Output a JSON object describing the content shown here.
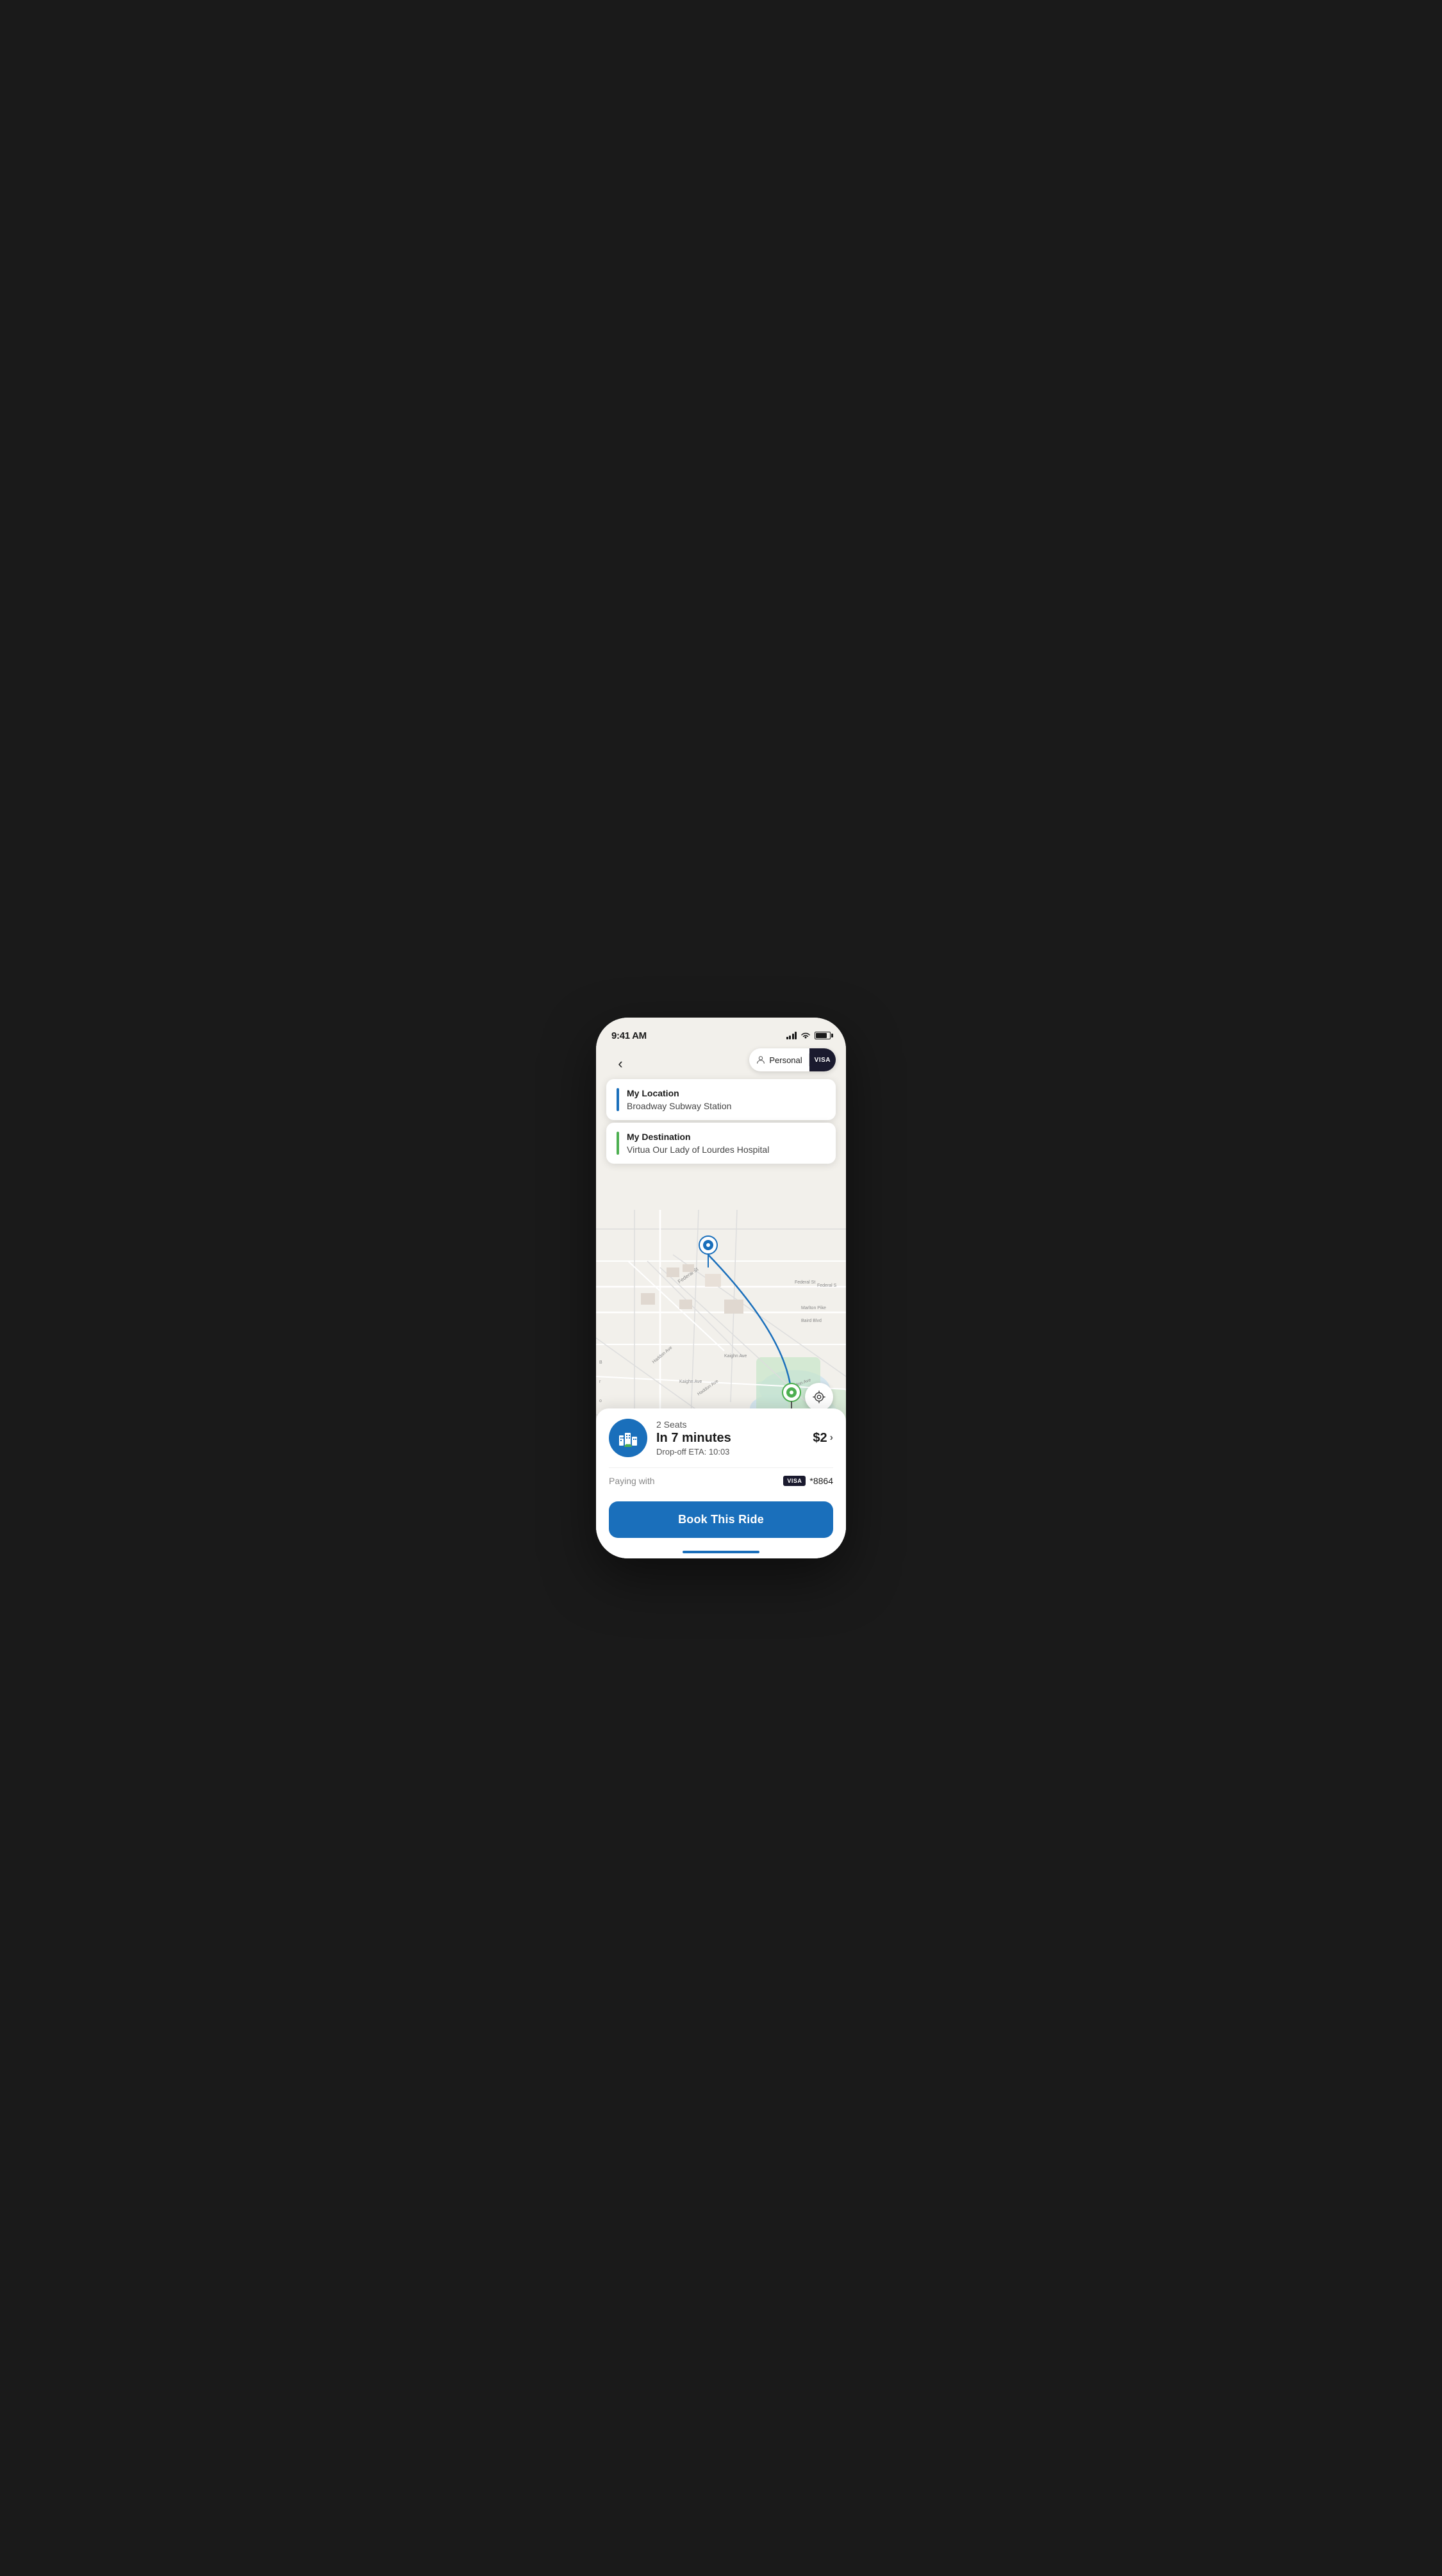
{
  "status_bar": {
    "time": "9:41 AM"
  },
  "header": {
    "account_type": "Personal",
    "card_label": "VISA",
    "back_label": "<"
  },
  "location": {
    "origin_label": "My Location",
    "origin_value": "Broadway Subway Station",
    "destination_label": "My Destination",
    "destination_value": "Virtua Our Lady of Lourdes Hospital"
  },
  "ride": {
    "seats": "2 Seats",
    "eta_label": "In 7 minutes",
    "dropoff_label": "Drop-off ETA: 10:03",
    "price": "$2",
    "price_chevron": "›"
  },
  "payment": {
    "label": "Paying with",
    "card_brand": "VISA",
    "card_last4": "*8864"
  },
  "book_button": {
    "label": "Book This Ride"
  },
  "icons": {
    "back": "‹",
    "locate": "⊕",
    "signal": "▊",
    "wifi": "WiFi",
    "battery": "Battery"
  }
}
